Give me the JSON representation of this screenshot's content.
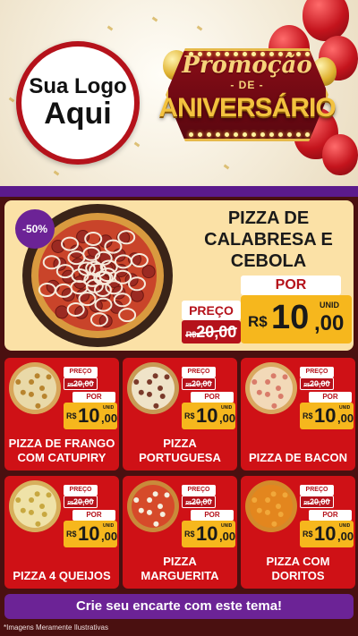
{
  "header": {
    "logo_line1": "Sua Logo",
    "logo_line2": "Aqui",
    "promo_top": "Promoção",
    "promo_de": "- DE -",
    "promo_main": "ANIVERSÁRIO"
  },
  "featured": {
    "badge": "-50%",
    "title": "PIZZA DE CALABRESA E CEBOLA",
    "price_label": "PREÇO",
    "old_currency": "R$",
    "old_price": "20,00",
    "por_label": "POR",
    "currency": "R$",
    "price_int": "10",
    "price_dec": ",00",
    "unit": "UNID"
  },
  "products": [
    {
      "name": "PIZZA DE FRANGO COM CATUPIRY",
      "price_label": "PREÇO",
      "old_currency": "R$",
      "old_price": "20,00",
      "por_label": "POR",
      "currency": "R$",
      "price_int": "10",
      "price_dec": ",00",
      "unit": "UNID"
    },
    {
      "name": "PIZZA PORTUGUESA",
      "price_label": "PREÇO",
      "old_currency": "R$",
      "old_price": "20,00",
      "por_label": "POR",
      "currency": "R$",
      "price_int": "10",
      "price_dec": ",00",
      "unit": "UNID"
    },
    {
      "name": "PIZZA DE BACON",
      "price_label": "PREÇO",
      "old_currency": "R$",
      "old_price": "20,00",
      "por_label": "POR",
      "currency": "R$",
      "price_int": "10",
      "price_dec": ",00",
      "unit": "UNID"
    },
    {
      "name": "PIZZA 4 QUEIJOS",
      "price_label": "PREÇO",
      "old_currency": "R$",
      "old_price": "20,00",
      "por_label": "POR",
      "currency": "R$",
      "price_int": "10",
      "price_dec": ",00",
      "unit": "UNID"
    },
    {
      "name": "PIZZA MARGUERITA",
      "price_label": "PREÇO",
      "old_currency": "R$",
      "old_price": "20,00",
      "por_label": "POR",
      "currency": "R$",
      "price_int": "10",
      "price_dec": ",00",
      "unit": "UNID"
    },
    {
      "name": "PIZZA COM DORITOS",
      "price_label": "PREÇO",
      "old_currency": "R$",
      "old_price": "20,00",
      "por_label": "POR",
      "currency": "R$",
      "price_int": "10",
      "price_dec": ",00",
      "unit": "UNID"
    }
  ],
  "cta": "Crie seu encarte com este tema!",
  "footnote": "*Imagens Meramente Ilustrativas",
  "colors": {
    "brand_red": "#cf1116",
    "purple": "#6c2396",
    "price_yellow": "#f6b71d",
    "cream": "#fbe1a6"
  }
}
